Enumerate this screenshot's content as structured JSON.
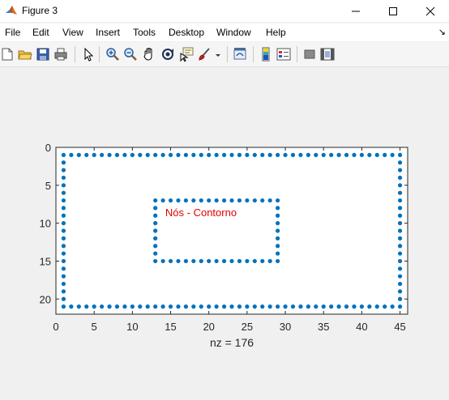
{
  "window": {
    "title": "Figure 3",
    "controls": [
      "minimize",
      "maximize",
      "close"
    ]
  },
  "menubar": {
    "items": [
      "File",
      "Edit",
      "View",
      "Insert",
      "Tools",
      "Desktop",
      "Window",
      "Help"
    ],
    "dock_icon": "↘"
  },
  "toolbar": {
    "icons": [
      "new-figure-icon",
      "open-file-icon",
      "save-icon",
      "print-icon",
      "edit-plot-icon",
      "zoom-in-icon",
      "zoom-out-icon",
      "pan-icon",
      "rotate-3d-icon",
      "data-cursor-icon",
      "brush-icon",
      "link-plot-icon",
      "insert-colorbar-icon",
      "insert-legend-icon",
      "hide-plot-tools-icon",
      "show-plot-tools-icon"
    ]
  },
  "chart_data": {
    "type": "scatter",
    "xlim": [
      0,
      46
    ],
    "ylim": [
      0,
      22
    ],
    "y_reversed": true,
    "xticks": [
      "0",
      "5",
      "10",
      "15",
      "20",
      "25",
      "30",
      "35",
      "40",
      "45"
    ],
    "yticks": [
      "0",
      "5",
      "10",
      "15",
      "20"
    ],
    "xlabel": "nz = 176",
    "annotation": "Nós - Contorno",
    "marker_color": "#0072bd",
    "grid": false,
    "series": [
      {
        "outer_rectangle": {
          "x": [
            1,
            45
          ],
          "y": [
            1,
            21
          ]
        }
      },
      {
        "inner_rectangle": {
          "x": [
            13,
            29
          ],
          "y": [
            7,
            15
          ]
        }
      }
    ]
  }
}
